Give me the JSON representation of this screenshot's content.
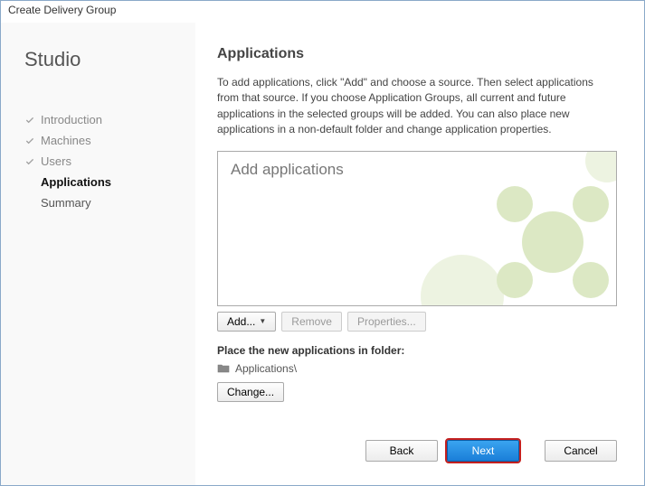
{
  "window": {
    "title": "Create Delivery Group"
  },
  "sidebar": {
    "studio_title": "Studio",
    "items": [
      {
        "label": "Introduction",
        "state": "done"
      },
      {
        "label": "Machines",
        "state": "done"
      },
      {
        "label": "Users",
        "state": "done"
      },
      {
        "label": "Applications",
        "state": "current"
      },
      {
        "label": "Summary",
        "state": "pending"
      }
    ]
  },
  "main": {
    "heading": "Applications",
    "intro": "To add applications, click \"Add\" and choose a source. Then select applications from that source. If you choose Application Groups, all current and future applications in the selected groups will be added. You can also place new applications in a non-default folder and change application properties.",
    "apps_placeholder": "Add applications",
    "toolbar": {
      "add_label": "Add...",
      "remove_label": "Remove",
      "properties_label": "Properties..."
    },
    "folder_caption": "Place the new applications in folder:",
    "folder_path": "Applications\\",
    "change_label": "Change..."
  },
  "wizard": {
    "back": "Back",
    "next": "Next",
    "cancel": "Cancel"
  }
}
